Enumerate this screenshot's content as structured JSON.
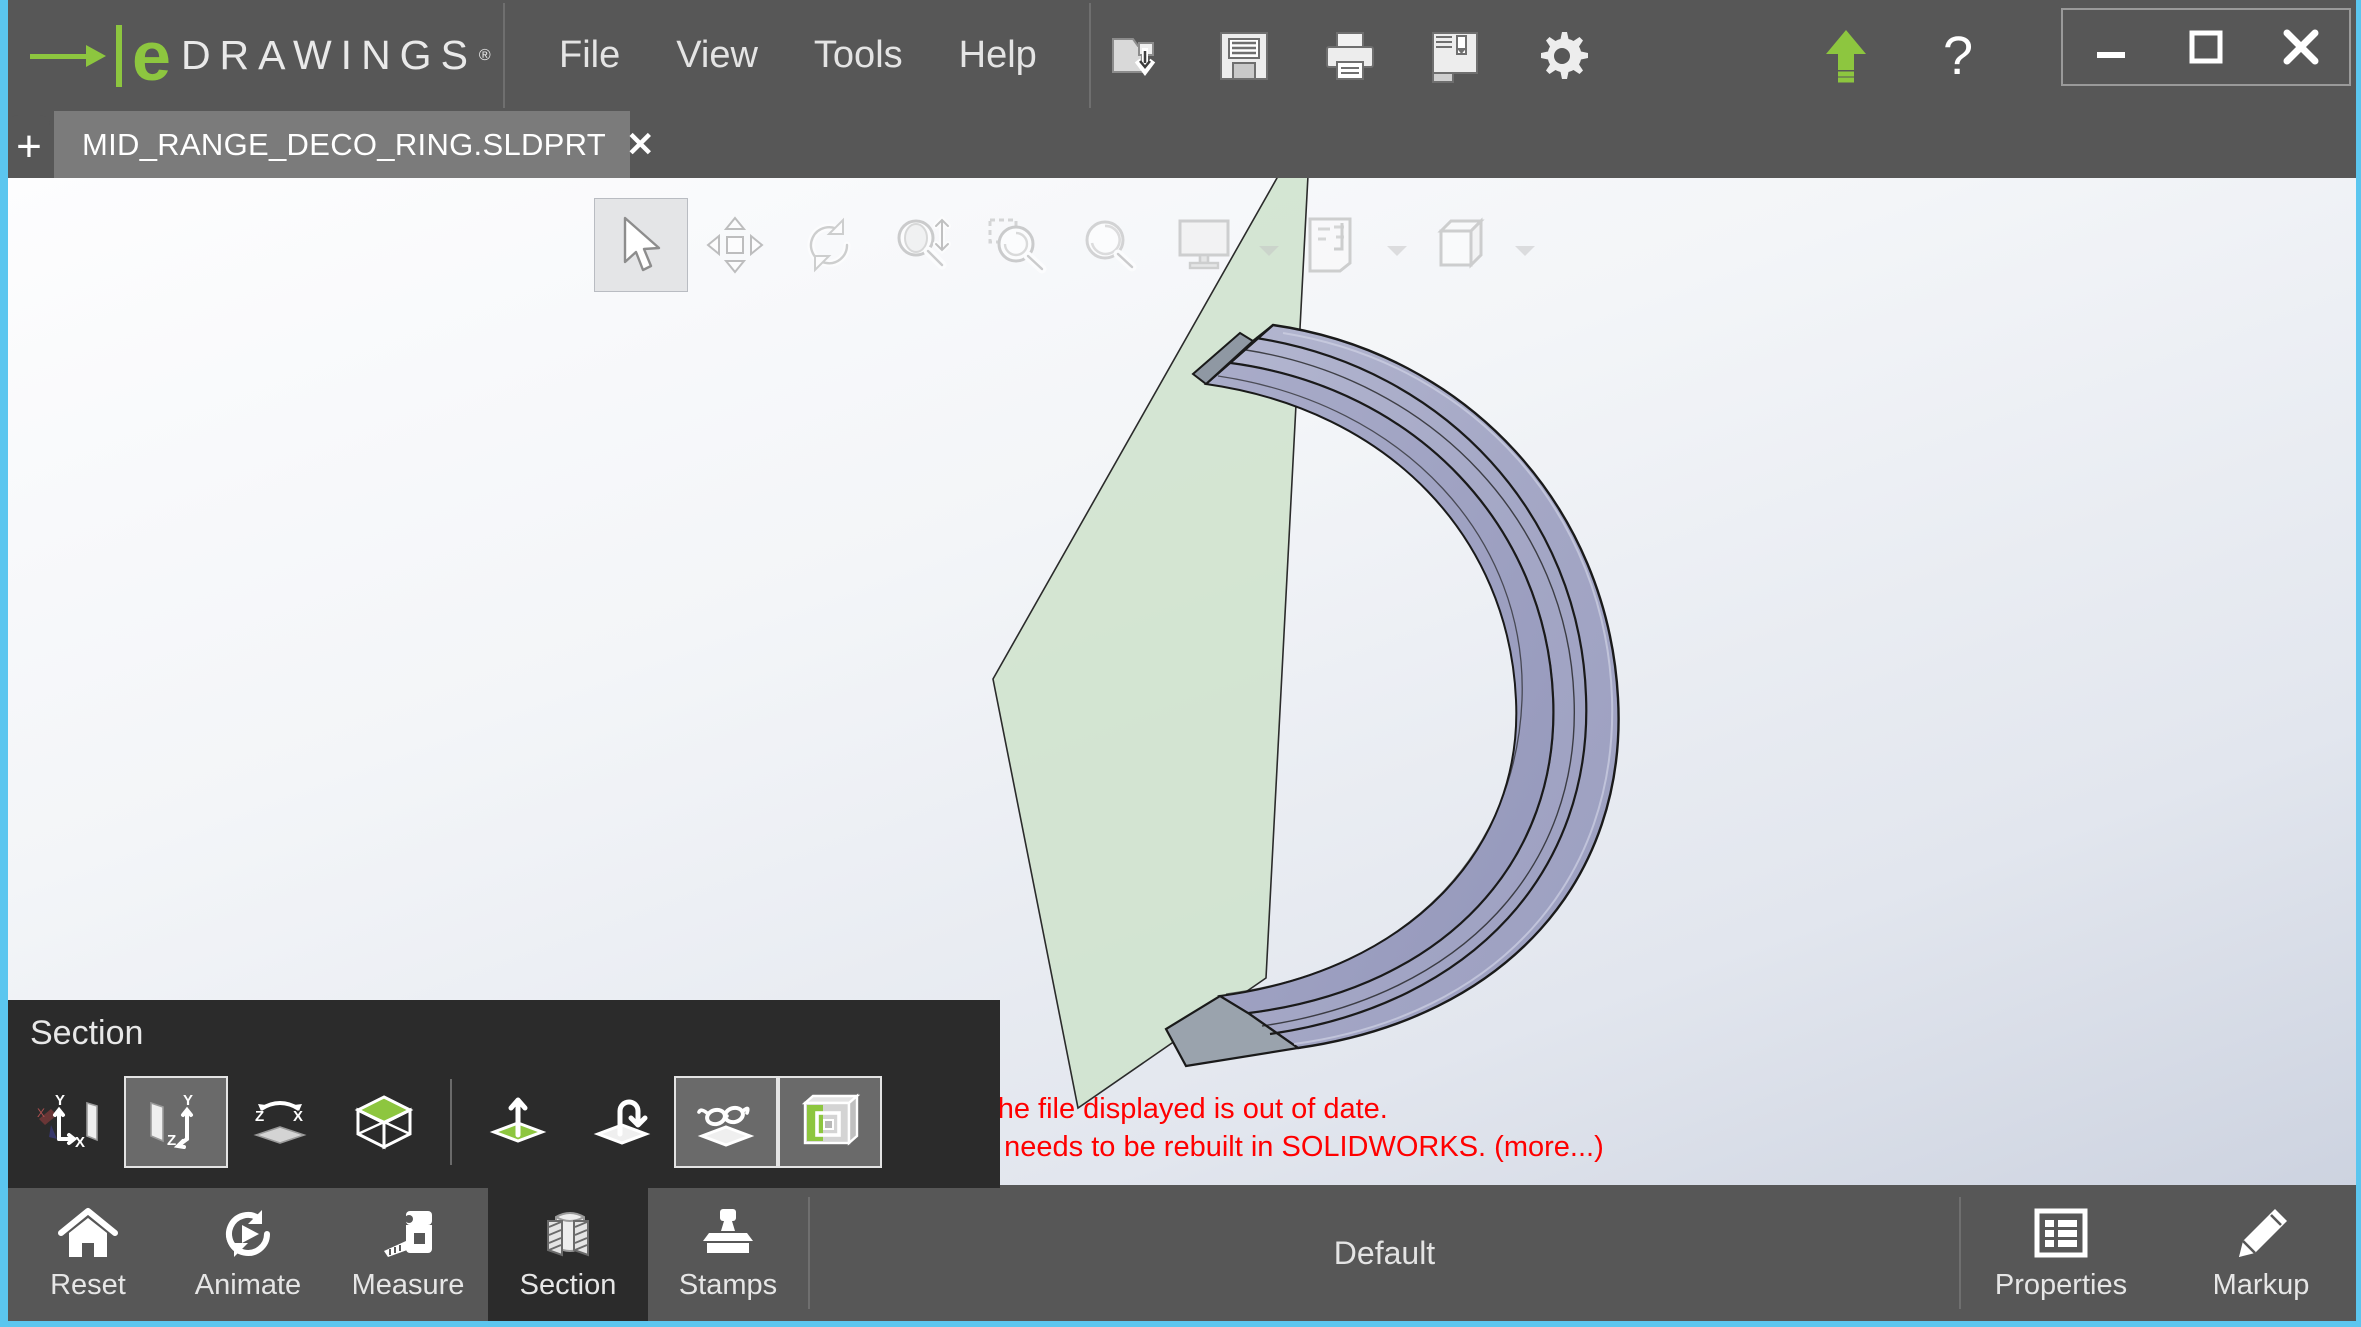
{
  "app": {
    "brand_e": "e",
    "brand_word": "DRAWINGS",
    "brand_reg": "®",
    "accent_green": "#8dc63f",
    "window_border": "#5bc6ef",
    "titlebar_bg": "#575757",
    "panel_bg": "#2b2b2b",
    "warning_color": "#ff0000"
  },
  "menu": {
    "items": [
      {
        "label": "File",
        "name": "menu-file"
      },
      {
        "label": "View",
        "name": "menu-view"
      },
      {
        "label": "Tools",
        "name": "menu-tools"
      },
      {
        "label": "Help",
        "name": "menu-help"
      }
    ]
  },
  "titlebar_tools": [
    {
      "icon": "open-file-icon",
      "title": "Open"
    },
    {
      "icon": "save-icon",
      "title": "Save"
    },
    {
      "icon": "print-icon",
      "title": "Print"
    },
    {
      "icon": "pack-and-go-icon",
      "title": "Pack and Go"
    },
    {
      "icon": "gear-icon",
      "title": "Options"
    }
  ],
  "titlebar_right": [
    {
      "icon": "upload-arrow-icon",
      "title": "Upload"
    },
    {
      "icon": "help-question-icon",
      "title": "Help"
    }
  ],
  "window_controls": [
    {
      "icon": "minimize-icon",
      "title": "Minimize"
    },
    {
      "icon": "maximize-icon",
      "title": "Maximize"
    },
    {
      "icon": "close-icon",
      "title": "Close"
    }
  ],
  "tabs": {
    "new_tab_label": "+",
    "active": {
      "filename": "MID_RANGE_DECO_RING.SLDPRT",
      "close_label": "✕",
      "icon": "part-document-icon"
    }
  },
  "viewport_toolbar": [
    {
      "icon": "select-arrow-icon",
      "label": "Select",
      "active": true,
      "caret": false
    },
    {
      "icon": "pan-icon",
      "label": "Pan",
      "active": false,
      "caret": false
    },
    {
      "icon": "rotate-icon",
      "label": "Rotate",
      "active": false,
      "caret": false
    },
    {
      "icon": "zoom-to-fit-icon",
      "label": "Zoom to Fit",
      "active": false,
      "caret": false
    },
    {
      "icon": "zoom-to-area-icon",
      "label": "Zoom to Area",
      "active": false,
      "caret": false
    },
    {
      "icon": "zoom-in-out-icon",
      "label": "Zoom In/Out",
      "active": false,
      "caret": false
    },
    {
      "icon": "display-view-icon",
      "label": "Views",
      "active": false,
      "caret": true
    },
    {
      "icon": "drawing-sheet-icon",
      "label": "Sheet",
      "active": false,
      "caret": true
    },
    {
      "icon": "shaded-cube-icon",
      "label": "Display Style",
      "active": false,
      "caret": true
    }
  ],
  "warning": {
    "line1": "The file displayed is out of date.",
    "line2": "It needs to be rebuilt in SOLIDWORKS. (more...)"
  },
  "section_panel": {
    "title": "Section",
    "buttons": [
      {
        "icon": "section-plane-xy-icon",
        "label": "XY Section Plane",
        "active": false,
        "group": 1
      },
      {
        "icon": "section-plane-yz-icon",
        "label": "YZ Section Plane",
        "active": true,
        "group": 1
      },
      {
        "icon": "section-plane-zx-icon",
        "label": "ZX Section Plane",
        "active": false,
        "group": 1
      },
      {
        "icon": "section-box-icon",
        "label": "Section Box",
        "active": false,
        "group": 1
      },
      {
        "icon": "move-plane-icon",
        "label": "Move Plane",
        "active": false,
        "group": 2
      },
      {
        "icon": "rotate-plane-icon",
        "label": "Rotate Plane",
        "active": false,
        "group": 2
      },
      {
        "icon": "show-plane-icon",
        "label": "Show Section Plane",
        "active": true,
        "group": 2
      },
      {
        "icon": "cap-section-icon",
        "label": "Cap Section",
        "active": true,
        "group": 2
      }
    ]
  },
  "bottom_bar": {
    "left_items": [
      {
        "icon": "home-icon",
        "label": "Reset",
        "active": false
      },
      {
        "icon": "animate-icon",
        "label": "Animate",
        "active": false
      },
      {
        "icon": "measure-icon",
        "label": "Measure",
        "active": false
      },
      {
        "icon": "section-icon",
        "label": "Section",
        "active": true
      },
      {
        "icon": "stamp-icon",
        "label": "Stamps",
        "active": false
      }
    ],
    "configuration": "Default",
    "right_items": [
      {
        "icon": "properties-list-icon",
        "label": "Properties",
        "active": false
      },
      {
        "icon": "markup-pencil-icon",
        "label": "Markup",
        "active": false
      }
    ]
  },
  "model": {
    "part_color": "#a8abc8",
    "section_plane_color": "#cfe2cd",
    "edge_color": "#1a1a1a"
  }
}
